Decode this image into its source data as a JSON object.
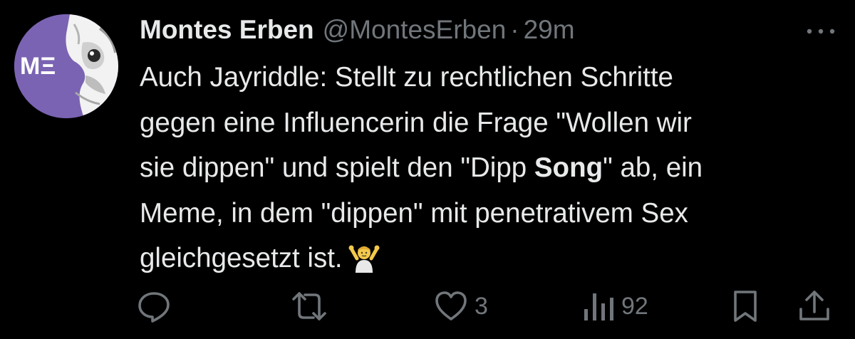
{
  "tweet": {
    "author": {
      "display_name": "Montes Erben",
      "handle": "@MontesErben",
      "avatar_monogram": "MΞ"
    },
    "separator": "·",
    "timestamp": "29m",
    "text": {
      "line1": "Auch Jayriddle: Stellt zu rechtlichen Schritte",
      "line2": "gegen eine Influencerin die Frage \"Wollen wir",
      "line3_before": "sie dippen\" und spielt den \"Dipp ",
      "line3_bold": "Song",
      "line3_after": "\" ab, ein",
      "line4": "Meme, in dem \"dippen\" mit penetrativem Sex",
      "line5": "gleichgesetzt ist."
    },
    "actions": {
      "reply_count": "",
      "retweet_count": "",
      "like_count": "3",
      "views_count": "92"
    }
  },
  "colors": {
    "background": "#000000",
    "primary_text": "#e7e9ea",
    "secondary_text": "#71767b",
    "avatar_accent": "#7a63b3"
  },
  "icons": {
    "reply": "reply-icon",
    "retweet": "retweet-icon",
    "like": "heart-icon",
    "views": "views-icon",
    "bookmark": "bookmark-icon",
    "share": "share-icon",
    "more": "more-icon",
    "emoji": "person-shrugging-emoji"
  }
}
